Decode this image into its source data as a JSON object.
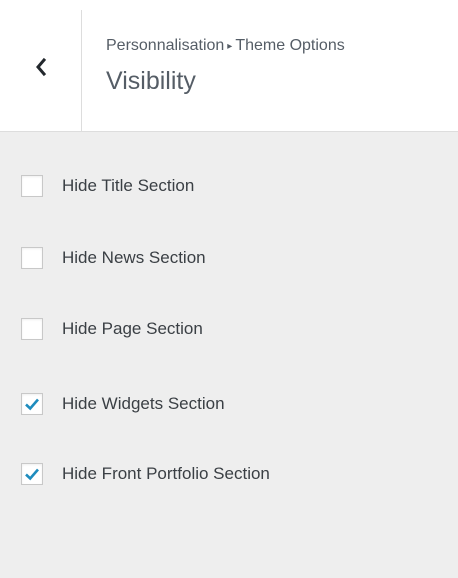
{
  "header": {
    "back_icon": "chevron-left-icon",
    "breadcrumb": {
      "parent": "Personnalisation",
      "separator": "▸",
      "current": "Theme Options"
    },
    "title": "Visibility"
  },
  "options": [
    {
      "label": "Hide Title Section",
      "checked": false
    },
    {
      "label": "Hide News Section",
      "checked": false
    },
    {
      "label": "Hide Page Section",
      "checked": false
    },
    {
      "label": "Hide Widgets Section",
      "checked": true
    },
    {
      "label": "Hide Front Portfolio Section",
      "checked": true
    }
  ],
  "colors": {
    "accent": "#1e8cbe",
    "background": "#eeeeee",
    "header_background": "#ffffff"
  }
}
